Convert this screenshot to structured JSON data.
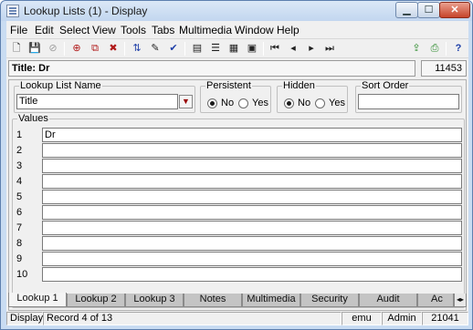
{
  "window": {
    "title": "Lookup Lists (1) - Display"
  },
  "controls": {
    "minimize": "▁",
    "maximize": "☐",
    "close": "✕"
  },
  "menu": [
    "File",
    "Edit",
    "Select",
    "View",
    "Tools",
    "Tabs",
    "Multimedia",
    "Window",
    "Help"
  ],
  "toolbar": {
    "icons": [
      {
        "name": "new-icon",
        "glyph": "🗋"
      },
      {
        "name": "save-icon",
        "glyph": "💾"
      },
      {
        "name": "cancel-icon",
        "glyph": "⊘"
      },
      {
        "name": "add-record-icon",
        "glyph": "⊕"
      },
      {
        "name": "copy-record-icon",
        "glyph": "⧉"
      },
      {
        "name": "delete-record-icon",
        "glyph": "✖"
      },
      {
        "name": "sort-icon",
        "glyph": "⇅"
      },
      {
        "name": "edit-icon",
        "glyph": "✎"
      },
      {
        "name": "spell-check-icon",
        "glyph": "✔"
      },
      {
        "name": "record-view-icon",
        "glyph": "▤"
      },
      {
        "name": "list-view-icon",
        "glyph": "☰"
      },
      {
        "name": "report-icon",
        "glyph": "▦"
      },
      {
        "name": "page-view-icon",
        "glyph": "▣"
      },
      {
        "name": "first-record-icon",
        "glyph": "⏮"
      },
      {
        "name": "previous-record-icon",
        "glyph": "◂"
      },
      {
        "name": "next-record-icon",
        "glyph": "▸"
      },
      {
        "name": "last-record-icon",
        "glyph": "⏭"
      },
      {
        "name": "export-icon",
        "glyph": "⇪"
      },
      {
        "name": "print-icon",
        "glyph": "⎙"
      },
      {
        "name": "help-icon",
        "glyph": "?"
      }
    ]
  },
  "header": {
    "title": "Title: Dr",
    "irn": "11453"
  },
  "form": {
    "lookup_list_name_label": "Lookup List Name",
    "lookup_list_name_value": "Title",
    "persistent_label": "Persistent",
    "hidden_label": "Hidden",
    "no_label": "No",
    "yes_label": "Yes",
    "sort_order_label": "Sort Order",
    "sort_order_value": "",
    "values_label": "Values",
    "values": [
      {
        "num": "1",
        "value": "Dr"
      },
      {
        "num": "2",
        "value": ""
      },
      {
        "num": "3",
        "value": ""
      },
      {
        "num": "4",
        "value": ""
      },
      {
        "num": "5",
        "value": ""
      },
      {
        "num": "6",
        "value": ""
      },
      {
        "num": "7",
        "value": ""
      },
      {
        "num": "8",
        "value": ""
      },
      {
        "num": "9",
        "value": ""
      },
      {
        "num": "10",
        "value": ""
      }
    ]
  },
  "tabs": [
    "Lookup 1",
    "Lookup 2",
    "Lookup 3",
    "Notes",
    "Multimedia",
    "Security",
    "Audit",
    "Ac"
  ],
  "status": {
    "mode": "Display",
    "record": "Record 4 of 13",
    "module": "emu",
    "user": "Admin",
    "number": "21041"
  }
}
